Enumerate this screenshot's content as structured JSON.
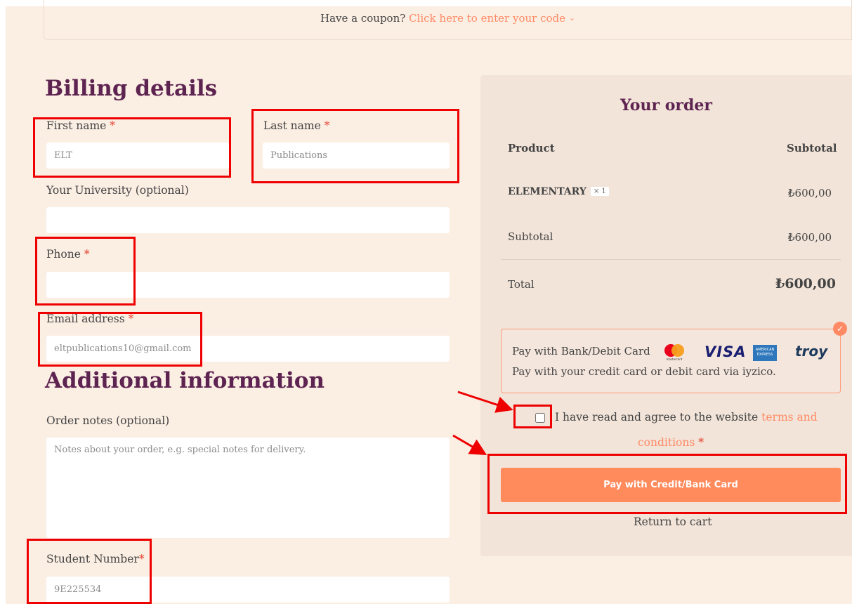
{
  "coupon": {
    "prompt": "Have a coupon?",
    "link": "Click here to enter your code",
    "chevron_icon": "chevron-down-icon"
  },
  "billing": {
    "heading": "Billing details",
    "first_name": {
      "label": "First name",
      "required": "*",
      "value": "ELT"
    },
    "last_name": {
      "label": "Last name",
      "required": "*",
      "value": "Publications"
    },
    "university": {
      "label": "Your University (optional)",
      "value": ""
    },
    "phone": {
      "label": "Phone",
      "required": "*",
      "value": ""
    },
    "email": {
      "label": "Email address",
      "required": "*",
      "value": "eltpublications10@gmail.com"
    }
  },
  "additional": {
    "heading": "Additional information",
    "notes": {
      "label": "Order notes (optional)",
      "placeholder": "Notes about your order, e.g. special notes for delivery."
    },
    "student_number": {
      "label": "Student Number",
      "required": "*",
      "value": "9E225534"
    }
  },
  "order": {
    "heading": "Your order",
    "col_product": "Product",
    "col_subtotal": "Subtotal",
    "item": {
      "name": "ELEMENTARY",
      "qty": "× 1",
      "price": "₺600,00"
    },
    "subtotal_label": "Subtotal",
    "subtotal_value": "₺600,00",
    "total_label": "Total",
    "total_value": "₺600,00"
  },
  "payment": {
    "method_label": "Pay with Bank/Debit Card",
    "description": "Pay with your credit card or debit card via iyzico.",
    "logos": [
      "mastercard",
      "VISA",
      "AMERICAN EXPRESS",
      "troy"
    ],
    "selected_icon": "check-icon"
  },
  "terms": {
    "text": "I have read and agree to the website",
    "link": "terms and conditions",
    "required": "*"
  },
  "pay_button": "Pay with Credit/Bank Card",
  "return_link": "Return to cart",
  "colors": {
    "accent": "#ff8a65",
    "heading": "#5e2451",
    "annotation": "#ee0000",
    "page_bg": "#fbeee3",
    "panel_bg": "#f2e4d9"
  }
}
